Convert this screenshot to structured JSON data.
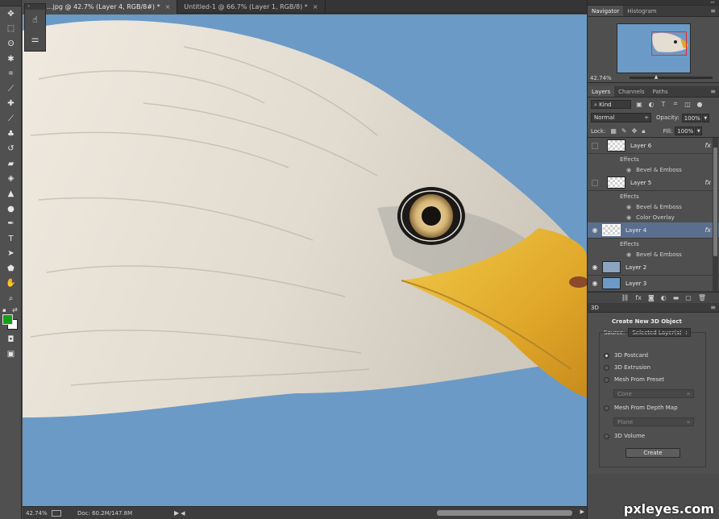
{
  "tabs": [
    {
      "label": "...jpg @ 42.7% (Layer 4, RGB/8#) *",
      "close": "×"
    },
    {
      "label": "Untitled-1 @ 66.7% (Layer 1, RGB/8) *",
      "close": "×"
    }
  ],
  "toolbar": {
    "tools": [
      "move-icon",
      "marquee-icon",
      "lasso-icon",
      "magic-wand-icon",
      "crop-icon",
      "eyedropper-icon",
      "spot-healing-icon",
      "brush-icon",
      "clone-stamp-icon",
      "history-brush-icon",
      "eraser-icon",
      "paint-bucket-icon",
      "blur-icon",
      "dodge-icon",
      "pen-icon",
      "type-icon",
      "path-selection-icon",
      "shape-icon",
      "hand-icon",
      "zoom-icon"
    ],
    "foreground_color": "#14a014",
    "background_color": "#ffffff"
  },
  "status": {
    "zoom": "42.74%",
    "doc": "Doc: 60.2M/147.8M"
  },
  "navigator": {
    "tabs": [
      "Navigator",
      "Histogram"
    ],
    "zoom": "42.74%"
  },
  "layers_panel": {
    "tabs": [
      "Layers",
      "Channels",
      "Paths"
    ],
    "kind": "Kind",
    "blend_mode": "Normal",
    "opacity_label": "Opacity:",
    "opacity": "100%",
    "lock_label": "Lock:",
    "fill_label": "Fill:",
    "fill": "100%",
    "layers": [
      {
        "name": "Layer 6",
        "visible": false,
        "fx": "fx",
        "effects_label": "Effects",
        "effects": [
          "Bevel & Emboss"
        ]
      },
      {
        "name": "Layer 5",
        "visible": false,
        "fx": "fx",
        "effects_label": "Effects",
        "effects": [
          "Bevel & Emboss",
          "Color Overlay"
        ]
      },
      {
        "name": "Layer 4",
        "visible": true,
        "selected": true,
        "fx": "fx",
        "effects_label": "Effects",
        "effects": [
          "Bevel & Emboss"
        ]
      },
      {
        "name": "Layer 2",
        "visible": true
      },
      {
        "name": "Layer 3",
        "visible": true
      }
    ]
  },
  "panel_3d": {
    "tab": "3D",
    "title": "Create New 3D Object",
    "source_label": "Source:",
    "source_value": "Selected Layer(s)",
    "options": [
      "3D Postcard",
      "3D Extrusion",
      "Mesh From Preset",
      "Mesh From Depth Map",
      "3D Volume"
    ],
    "selected_option": "3D Postcard",
    "preset_value": "Cone",
    "depth_value": "Plane",
    "create_label": "Create"
  },
  "watermark": "pxleyes.com",
  "colors": {
    "canvas_bg": "#6b9ac7",
    "selected_layer": "#5a6f8e"
  }
}
